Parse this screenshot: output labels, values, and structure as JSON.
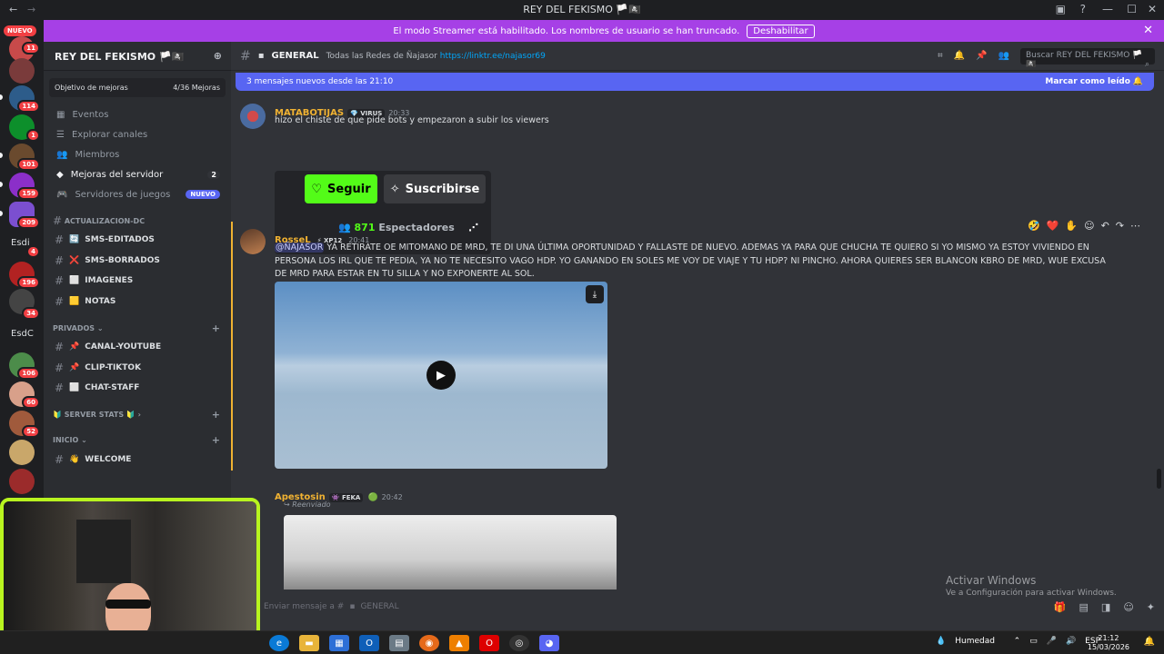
{
  "window": {
    "title": "REY DEL FEKISMO 🏳️🏴‍☠️"
  },
  "banner": {
    "text": "El modo Streamer está habilitado. Los nombres de usuario se han truncado.",
    "button": "Deshabilitar"
  },
  "servers": {
    "nuevo_label": "NUEVO",
    "badges": [
      "11",
      "114",
      "1",
      "101",
      "159",
      "209",
      "4",
      "196",
      "34",
      "106",
      "60",
      "52"
    ],
    "folder_labels": [
      "Esdi",
      "EsdC"
    ]
  },
  "sidebar": {
    "server_name": "REY DEL FEKISMO 🏳️🏴‍☠️",
    "goal": {
      "label": "Objetivo de mejoras",
      "progress": "4/36 Mejoras"
    },
    "items": [
      {
        "label": "Eventos",
        "icon": "calendar-icon"
      },
      {
        "label": "Explorar canales",
        "icon": "browse-icon"
      },
      {
        "label": "Miembros",
        "icon": "members-icon"
      },
      {
        "label": "Mejoras del servidor",
        "icon": "boost-icon",
        "count": "2"
      },
      {
        "label": "Servidores de juegos",
        "icon": "game-icon",
        "badge": "NUEVO"
      }
    ],
    "categories": [
      {
        "name": "ACTUALIZACION-DC",
        "channels": [
          {
            "emoji": "🔄",
            "name": "SMS-EDITADOS"
          },
          {
            "emoji": "❌",
            "name": "SMS-BORRADOS"
          },
          {
            "emoji": "⬜",
            "name": "IMAGENES"
          },
          {
            "emoji": "🟨",
            "name": "NOTAS"
          }
        ]
      },
      {
        "name": "PRIVADOS",
        "channels": [
          {
            "emoji": "📌",
            "name": "CANAL-YOUTUBE"
          },
          {
            "emoji": "📌",
            "name": "CLIP-TIKTOK"
          },
          {
            "emoji": "⬜",
            "name": "CHAT-STAFF"
          }
        ]
      },
      {
        "name": "🔰 SERVER STATS 🔰",
        "channels": []
      },
      {
        "name": "INICIO",
        "channels": [
          {
            "emoji": "👋",
            "name": "WELCOME"
          }
        ]
      }
    ]
  },
  "topbar": {
    "channel": "GENERAL",
    "topic": "Todas las Redes de Ñajasor",
    "link": "https://linktr.ee/najasor69",
    "search_placeholder": "Buscar REY DEL FEKISMO 🏳️🏴‍☠️"
  },
  "new_messages": {
    "text": "3 mensajes nuevos desde las 21:10",
    "action": "Marcar como leído"
  },
  "messages": [
    {
      "author": "MATABOTIJAS",
      "tag": "VIRUS",
      "time": "20:33",
      "color": "#f0b232",
      "text": "hizo el chiste de que pide bots y empezaron a subir los viewers",
      "card": {
        "follow": "Seguir",
        "subscribe": "Suscribirse",
        "viewers_count": "871",
        "viewers_label": "Espectadores"
      }
    },
    {
      "author": "RosseL",
      "tag": "XP12",
      "time": "20:41",
      "color": "#f0b232",
      "mention": "@ÑAJASOR",
      "text": " YA RETIRATE OE MITOMANO DE MRD, TE DI UNA ÚLTIMA OPORTUNIDAD Y FALLASTE DE NUEVO. ADEMAS YA PARA QUE CHUCHA TE QUIERO SI YO MISMO YA ESTOY VIVIENDO EN PERSONA LOS IRL QUE TE PEDIA, YA NO TE NECESITO VAGO HDP. YO GANANDO EN SOLES ME VOY DE VIAJE Y TU HDP? NI PINCHO. AHORA QUIERES SER BLANCON KBRO DE MRD, WUE EXCUSA DE MRD PARA ESTAR EN TU SILLA Y NO EXPONERTE AL SOL."
    },
    {
      "author": "Apestosin",
      "tag": "FEKA",
      "time": "20:42",
      "color": "#f0b232",
      "forwarded": "Reenviado"
    }
  ],
  "input": {
    "placeholder": "Enviar mensaje a #",
    "channel": "GENERAL"
  },
  "activate_windows": {
    "title": "Activar Windows",
    "subtitle": "Ve a Configuración para activar Windows."
  },
  "taskbar": {
    "weather": "Humedad",
    "lang": "ESP",
    "time": "21:12",
    "date": "15/03/2026"
  }
}
